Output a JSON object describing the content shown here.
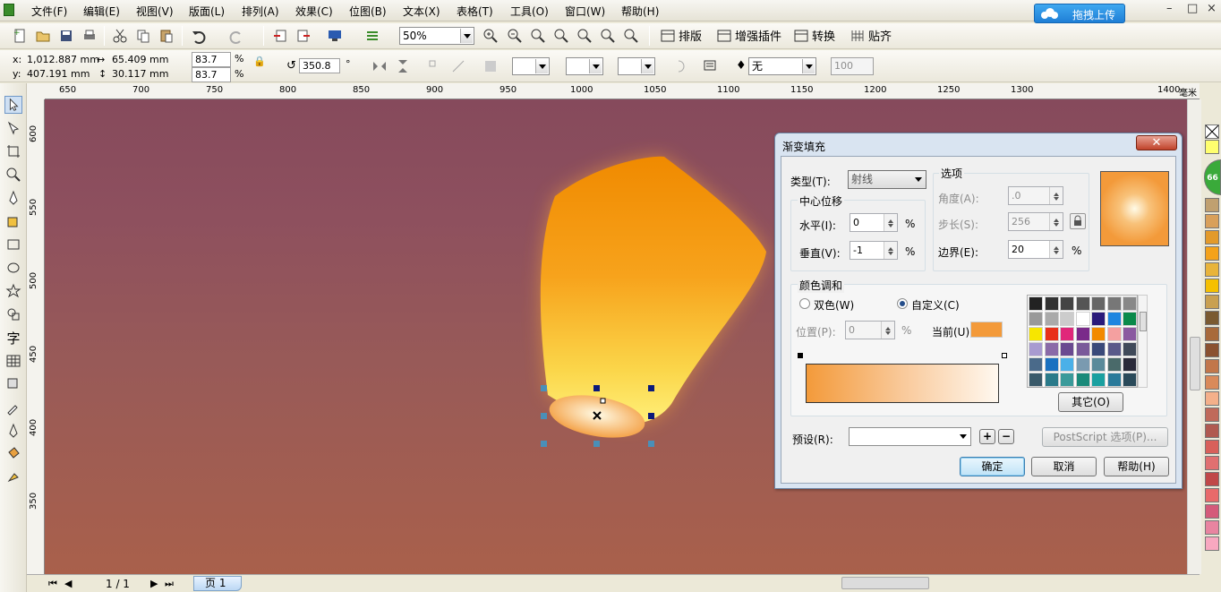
{
  "menubar": {
    "items": [
      "文件(F)",
      "编辑(E)",
      "视图(V)",
      "版面(L)",
      "排列(A)",
      "效果(C)",
      "位图(B)",
      "文本(X)",
      "表格(T)",
      "工具(O)",
      "窗口(W)",
      "帮助(H)"
    ],
    "upload_label": "拖拽上传",
    "minimize": "–",
    "restore": "□",
    "close": "×"
  },
  "toolbar1": {
    "zoom": "50%",
    "layout_btn": "排版",
    "plugin_btn": "增强插件",
    "convert_btn": "转换",
    "snap_btn": "贴齐"
  },
  "toolbar2": {
    "x_label": "x:",
    "x": "1,012.887 mm",
    "y_label": "y:",
    "y": "407.191 mm",
    "w": "65.409 mm",
    "h": "30.117 mm",
    "scale_x": "83.7",
    "scale_y": "83.7",
    "pct": "%",
    "rotation": "350.8",
    "degree": "°",
    "outline": "无",
    "opacity": "100"
  },
  "ruler": {
    "h_ticks": [
      "650",
      "700",
      "750",
      "800",
      "850",
      "900",
      "950",
      "1000",
      "1050",
      "1100",
      "1150",
      "1200",
      "1250",
      "1300",
      "1400"
    ],
    "unit": "毫米",
    "v_ticks": [
      "600",
      "550",
      "500",
      "450",
      "400",
      "350"
    ]
  },
  "statusbar": {
    "page_count": "1 / 1",
    "page_tab": "页 1"
  },
  "dialog": {
    "title": "渐变填充",
    "close": "✕",
    "type_label": "类型(T):",
    "type_value": "射线",
    "center_group": "中心位移",
    "horiz_label": "水平(I):",
    "horiz_value": "0",
    "vert_label": "垂直(V):",
    "vert_value": "-1",
    "pct": "%",
    "options_group": "选项",
    "angle_label": "角度(A):",
    "angle_value": ".0",
    "steps_label": "步长(S):",
    "steps_value": "256",
    "edge_label": "边界(E):",
    "edge_value": "20",
    "blend_group": "颜色调和",
    "two_color": "双色(W)",
    "custom": "自定义(C)",
    "position_label": "位置(P):",
    "position_value": "0",
    "current_label": "当前(U):",
    "other_btn": "其它(O)",
    "preset_label": "预设(R):",
    "postscript_btn": "PostScript 选项(P)...",
    "ok": "确定",
    "cancel": "取消",
    "help": "帮助(H)",
    "current_color": "#f39a3a"
  }
}
